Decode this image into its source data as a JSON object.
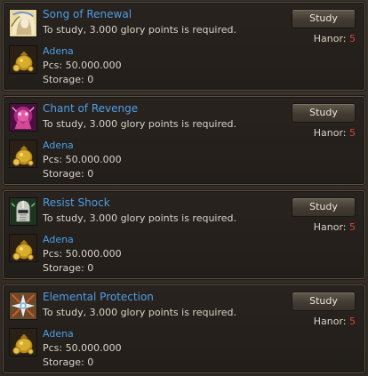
{
  "entries": [
    {
      "skill": "Song of Renewal",
      "skill_icon": "song-of-renewal-icon",
      "requirement": "To study, 3.000 glory points is required.",
      "study_label": "Study",
      "honor_label": "Hanor:",
      "honor_value": "5",
      "item": "Adena",
      "item_icon": "adena-coin-bag-icon",
      "pcs": "Pcs: 50.000.000",
      "storage": "Storage: 0"
    },
    {
      "skill": "Chant of Revenge",
      "skill_icon": "chant-of-revenge-icon",
      "requirement": "To study, 3.000 glory points is required.",
      "study_label": "Study",
      "honor_label": "Hanor:",
      "honor_value": "5",
      "item": "Adena",
      "item_icon": "adena-coin-bag-icon",
      "pcs": "Pcs: 50.000.000",
      "storage": "Storage: 0"
    },
    {
      "skill": "Resist Shock",
      "skill_icon": "resist-shock-icon",
      "requirement": "To study, 3.000 glory points is required.",
      "study_label": "Study",
      "honor_label": "Hanor:",
      "honor_value": "5",
      "item": "Adena",
      "item_icon": "adena-coin-bag-icon",
      "pcs": "Pcs: 50.000.000",
      "storage": "Storage: 0"
    },
    {
      "skill": "Elemental Protection",
      "skill_icon": "elemental-protection-icon",
      "requirement": "To study, 3.000 glory points is required.",
      "study_label": "Study",
      "honor_label": "Hanor:",
      "honor_value": "5",
      "item": "Adena",
      "item_icon": "adena-coin-bag-icon",
      "pcs": "Pcs: 50.000.000",
      "storage": "Storage: 0"
    }
  ],
  "colors": {
    "skill_name": "#4e9ee6",
    "honor_value": "#d0463c",
    "text": "#d8d2c8"
  }
}
